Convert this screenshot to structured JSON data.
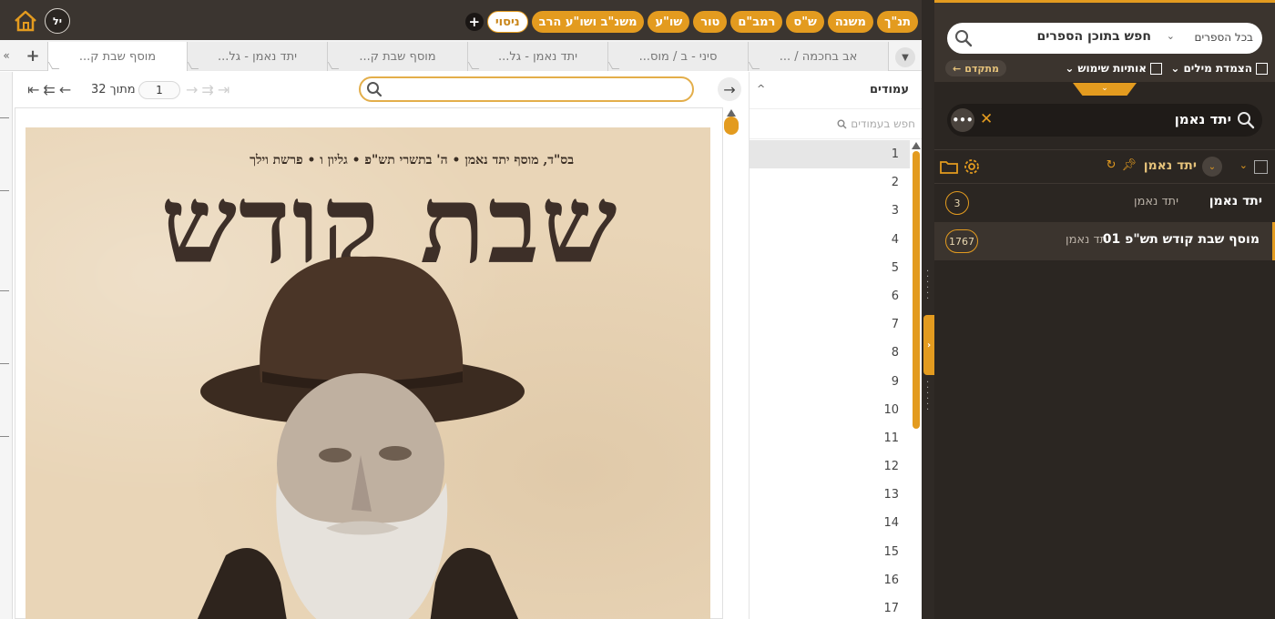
{
  "topbar": {
    "user_initials": "יל",
    "categories": [
      "תנ\"ך",
      "משנה",
      "ש\"ס",
      "רמב\"ם",
      "טור",
      "שו\"ע",
      "משנ\"ב ושו\"ע הרב",
      "ניסוי"
    ],
    "add_label": "+"
  },
  "tabs": {
    "items": [
      "אב בחכמה / ...",
      "סיני - ב / מוס...",
      "יתד נאמן - גל...",
      "מוסף שבת ק...",
      "יתד נאמן - גל...",
      "מוסף שבת ק..."
    ],
    "add_label": "+"
  },
  "viewer": {
    "page_current": "1",
    "page_of_text": "מתוך 32",
    "search_value": "",
    "document": {
      "header_line": "בס\"ד, מוסף יתד נאמן • ה' בתשרי תש\"פ • גליון ו • פרשת וילך",
      "title": "שבת קודש"
    }
  },
  "pages_panel": {
    "title": "עמודים",
    "search_placeholder": "חפש בעמודים",
    "pages": [
      "1",
      "2",
      "3",
      "4",
      "5",
      "6",
      "7",
      "8",
      "9",
      "10",
      "11",
      "12",
      "13",
      "14",
      "15",
      "16",
      "17"
    ],
    "selected": "1"
  },
  "sidebar": {
    "search_scope": "בכל הספרים",
    "search_placeholder": "חפש בתוכן הספרים",
    "option_word_adjacency": "הצמדת מילים",
    "option_prefixes": "אותיות שימוש",
    "advanced_label": "מתקדם",
    "filter_text": "יתד נאמן",
    "tree_node_title": "יתד נאמן",
    "results": [
      {
        "title": "יתד נאמן",
        "sub": "יתד נאמן",
        "count": "3"
      },
      {
        "title": "מוסף שבת קודש תש\"פ 01",
        "sub": "יתד נאמן",
        "count": "1767"
      }
    ]
  },
  "colors": {
    "accent": "#e39b1f",
    "dark_bar": "#3b3530",
    "sidebar_bg": "#2b2622"
  }
}
